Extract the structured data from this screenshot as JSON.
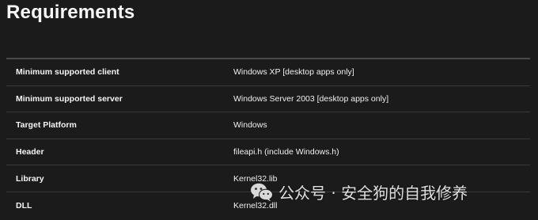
{
  "section": {
    "title": "Requirements"
  },
  "requirements": [
    {
      "key": "Minimum supported client",
      "value": "Windows XP [desktop apps only]"
    },
    {
      "key": "Minimum supported server",
      "value": "Windows Server 2003 [desktop apps only]"
    },
    {
      "key": "Target Platform",
      "value": "Windows"
    },
    {
      "key": "Header",
      "value": "fileapi.h (include Windows.h)"
    },
    {
      "key": "Library",
      "value": "Kernel32.lib"
    },
    {
      "key": "DLL",
      "value": "Kernel32.dll"
    }
  ],
  "watermark": {
    "text": "公众号 · 安全狗的自我修养",
    "icon": "wechat-icon"
  },
  "colors": {
    "background": "#1b1b1b",
    "text": "#f2f2f2",
    "divider": "#3a3a3a"
  }
}
